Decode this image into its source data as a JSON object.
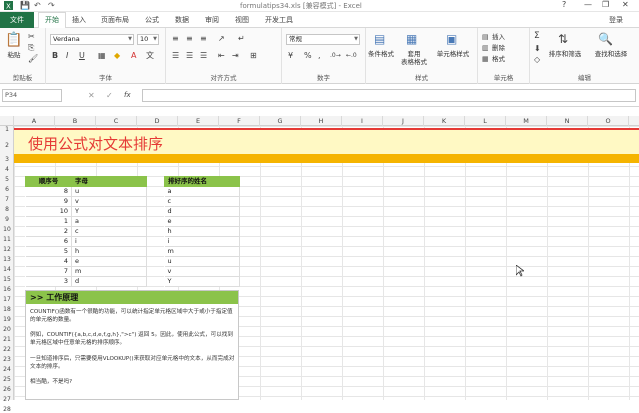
{
  "titlebar": {
    "title": "formulatips34.xls  [兼容模式] - Excel",
    "help": "?",
    "minimize": "—",
    "restore": "❐",
    "close": "✕",
    "undo": "↶",
    "redo": "↷",
    "save": "💾"
  },
  "tabs": {
    "file": "文件",
    "home": "开始",
    "insert": "插入",
    "layout": "页面布局",
    "formulas": "公式",
    "data": "数据",
    "review": "审阅",
    "view": "视图",
    "developer": "开发工具",
    "login": "登录"
  },
  "ribbon": {
    "clipboard": {
      "paste": "粘贴",
      "label": "剪贴板"
    },
    "font": {
      "name": "Verdana",
      "size": "10",
      "label": "字体"
    },
    "align": {
      "label": "对齐方式"
    },
    "number": {
      "format": "常规",
      "label": "数字",
      "percent": "%",
      "comma": ","
    },
    "styles": {
      "cond": "条件格式",
      "table": "套用\n表格格式",
      "cell": "单元格样式",
      "label": "样式"
    },
    "cells": {
      "insert": "插入",
      "delete": "删除",
      "format": "格式",
      "label": "单元格"
    },
    "editing": {
      "sort": "排序和筛选",
      "find": "查找和选择",
      "label": "编辑"
    }
  },
  "formula_bar": {
    "name_box": "P34",
    "fx": "fx",
    "cancel": "✕",
    "enter": "✓",
    "content": ""
  },
  "sheet": {
    "columns": [
      "A",
      "B",
      "C",
      "D",
      "E",
      "F",
      "G",
      "H",
      "I",
      "J",
      "K",
      "L",
      "M",
      "N",
      "O"
    ],
    "rows": [
      "1",
      "2",
      "3",
      "4",
      "5",
      "6",
      "7",
      "8",
      "9",
      "10",
      "11",
      "12",
      "13",
      "14",
      "15",
      "16",
      "17",
      "18",
      "19",
      "20",
      "21",
      "22",
      "23",
      "24",
      "25",
      "26",
      "27",
      "28"
    ],
    "banner_title": "使用公式对文本排序",
    "table1": {
      "headers": [
        "顺序号",
        "字母"
      ],
      "rows": [
        [
          "8",
          "u"
        ],
        [
          "9",
          "v"
        ],
        [
          "10",
          "Y"
        ],
        [
          "1",
          "a"
        ],
        [
          "2",
          "c"
        ],
        [
          "6",
          "i"
        ],
        [
          "5",
          "h"
        ],
        [
          "4",
          "e"
        ],
        [
          "7",
          "m"
        ],
        [
          "3",
          "d"
        ]
      ]
    },
    "table2": {
      "header": "排好序的姓名",
      "rows": [
        "a",
        "c",
        "d",
        "e",
        "h",
        "i",
        "m",
        "u",
        "v",
        "Y"
      ]
    },
    "principle": {
      "heading": ">> 工作原理",
      "p1": "COUNTIF()函数有一个很酷的功能，可以统计指定单元格区域中大于或小于指定值的单元格的数量。",
      "p2": "例如，COUNTIF({a,b,c,d,e,f,g,h},\">c\") 返回 5。因此，使用此公式，可以找到单元格区域中任意单元格的排序顺序。",
      "p3": "一旦知道排序后，只需要使用VLOOKUP()来获取对应单元格中的文本，从而完成对文本的排序。",
      "p4": "相当酷，不是吗?"
    }
  },
  "colors": {
    "accent": "#217346",
    "banner": "#fff9c4",
    "title_red": "#e53935",
    "orange": "#f5b400",
    "green": "#8bc34a"
  }
}
